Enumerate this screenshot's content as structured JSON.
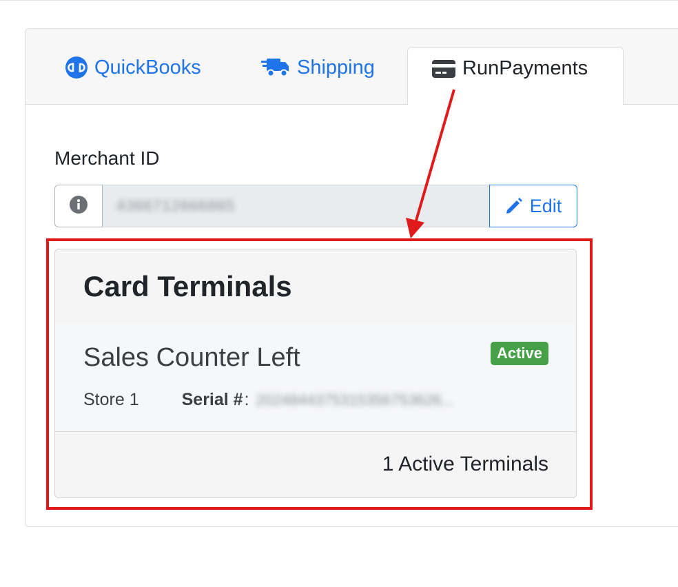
{
  "tabs": [
    {
      "label": "QuickBooks",
      "icon": "quickbooks-logo-icon",
      "active": false
    },
    {
      "label": "Shipping",
      "icon": "truck-icon",
      "active": false
    },
    {
      "label": "RunPayments",
      "icon": "credit-card-icon",
      "active": true
    }
  ],
  "merchant": {
    "label": "Merchant ID",
    "value": "4366712666865",
    "edit_label": "Edit"
  },
  "terminals": {
    "title": "Card Terminals",
    "items": [
      {
        "name": "Sales Counter Left",
        "status": "Active",
        "store": "Store 1",
        "serial_label": "Serial #",
        "serial_value": "2024844375315356753626..."
      }
    ],
    "footer": "1 Active Terminals"
  },
  "colors": {
    "link": "#1e74e8",
    "badge_active": "#45a047",
    "annotation_red": "#e0191b"
  }
}
